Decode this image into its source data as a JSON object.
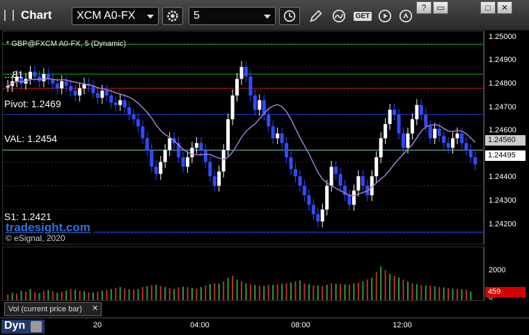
{
  "app": {
    "title": "Chart"
  },
  "toolbar": {
    "symbol": "XCM A0-FX",
    "interval": "5",
    "icons": [
      "gear-icon",
      "clock-icon",
      "pencil-icon",
      "curve-icon",
      "get-icon",
      "play-icon",
      "help-icon"
    ],
    "get_label": "GET",
    "window_buttons": [
      "?",
      "▭",
      "□",
      "✕"
    ]
  },
  "study_label": "* GBP@FXCM A0-FX, 5 (Dynamic)",
  "levels": {
    "pivot": "Pivot: 1.2469",
    "val": "VAL: 1.2454",
    "s1": "S1: 1.2421",
    "partial": "...81"
  },
  "brand": {
    "name": "tradesight.com",
    "copyright": "© eSignal, 2020"
  },
  "price_axis": {
    "labels": [
      "1.25000",
      "1.24900",
      "1.24800",
      "1.24700",
      "1.24600",
      "1.24400",
      "1.24300",
      "1.24200"
    ],
    "tag_upper": "1.24560",
    "tag_current": "1.24495"
  },
  "volume": {
    "label": "Vol (current price bar)",
    "axis_label": "2000",
    "axis_zero": "0",
    "tag": "459"
  },
  "time_axis": {
    "labels": [
      "20",
      "04:00",
      "08:00",
      "12:00"
    ]
  },
  "status": {
    "mode": "Dyn"
  },
  "colors": {
    "up": "#ffffff",
    "down": "#2f4cff",
    "sma": "#a080d0",
    "magenta": "#ff33ff",
    "green": "#33cc33",
    "yellow": "#ffff00"
  },
  "chart_data": {
    "type": "candlestick",
    "ylim": [
      1.2415,
      1.2505
    ],
    "x_ticks": [
      "20",
      "04:00",
      "08:00",
      "12:00"
    ],
    "closes": [
      1.2482,
      1.2484,
      1.2486,
      1.2483,
      1.2485,
      1.2488,
      1.2486,
      1.2484,
      1.2487,
      1.2485,
      1.2483,
      1.2481,
      1.2484,
      1.2482,
      1.248,
      1.2478,
      1.2481,
      1.2483,
      1.2482,
      1.2479,
      1.2477,
      1.248,
      1.2478,
      1.2475,
      1.2474,
      1.2476,
      1.2473,
      1.247,
      1.2468,
      1.2465,
      1.246,
      1.2455,
      1.2448,
      1.2445,
      1.245,
      1.2455,
      1.246,
      1.2458,
      1.2452,
      1.2448,
      1.2452,
      1.2456,
      1.2458,
      1.2455,
      1.245,
      1.2444,
      1.244,
      1.2446,
      1.2455,
      1.2468,
      1.2478,
      1.2485,
      1.249,
      1.2486,
      1.2478,
      1.2472,
      1.2476,
      1.247,
      1.2465,
      1.246,
      1.2462,
      1.2458,
      1.2452,
      1.2447,
      1.2444,
      1.244,
      1.2436,
      1.2432,
      1.2428,
      1.2425,
      1.243,
      1.244,
      1.2448,
      1.2445,
      1.244,
      1.2436,
      1.2432,
      1.2438,
      1.2444,
      1.244,
      1.2436,
      1.2444,
      1.2452,
      1.246,
      1.2466,
      1.2472,
      1.247,
      1.2462,
      1.2456,
      1.2462,
      1.2468,
      1.2474,
      1.247,
      1.2465,
      1.246,
      1.2464,
      1.2461,
      1.2458,
      1.2456,
      1.246,
      1.2462,
      1.2458,
      1.2455,
      1.2452,
      1.2449
    ],
    "volume": [
      300,
      400,
      350,
      500,
      450,
      600,
      420,
      380,
      500,
      550,
      480,
      400,
      450,
      520,
      600,
      550,
      500,
      480,
      420,
      400,
      450,
      500,
      550,
      600,
      650,
      700,
      620,
      580,
      560,
      600,
      700,
      750,
      800,
      820,
      760,
      700,
      650,
      600,
      680,
      720,
      700,
      650,
      620,
      700,
      780,
      850,
      900,
      880,
      1000,
      1200,
      1300,
      1100,
      1000,
      900,
      850,
      800,
      780,
      760,
      800,
      820,
      850,
      880,
      900,
      950,
      1000,
      1050,
      900,
      850,
      800,
      780,
      760,
      820,
      900,
      880,
      860,
      840,
      820,
      900,
      950,
      1000,
      1100,
      1200,
      1500,
      1800,
      1600,
      1400,
      1300,
      1200,
      1100,
      1000,
      900,
      850,
      800,
      780,
      760,
      740,
      700,
      680,
      650,
      620,
      600,
      580,
      560,
      459
    ]
  }
}
